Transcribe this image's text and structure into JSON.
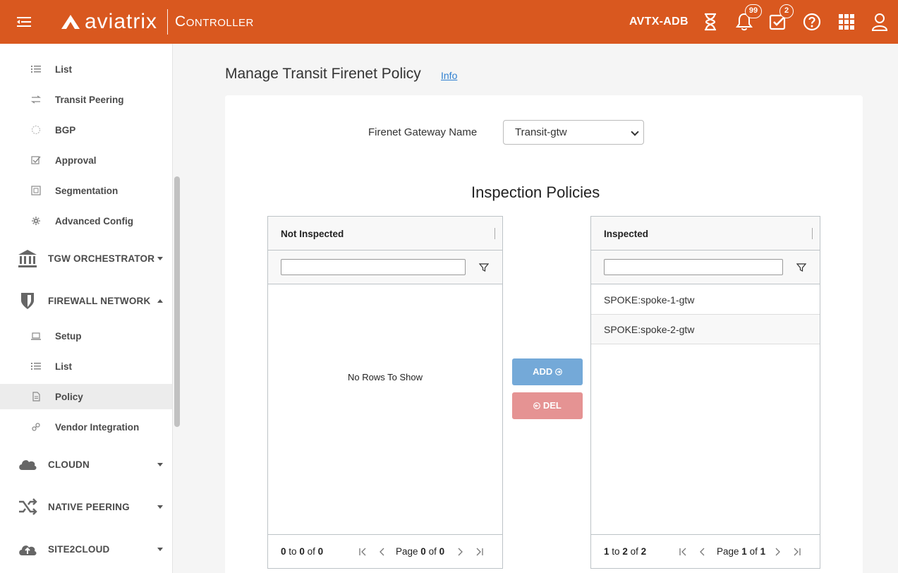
{
  "header": {
    "brand": "aviatrix",
    "product": "Controller",
    "account": "AVTX-ADB",
    "notifications_count": "99",
    "tasks_count": "2",
    "colors": {
      "bar": "#d9581f"
    }
  },
  "sidebar": {
    "items": [
      {
        "label": "List",
        "icon": "list-icon"
      },
      {
        "label": "Transit Peering",
        "icon": "arrows-icon"
      },
      {
        "label": "BGP",
        "icon": "bgp-icon"
      },
      {
        "label": "Approval",
        "icon": "approval-icon"
      },
      {
        "label": "Segmentation",
        "icon": "segmentation-icon"
      },
      {
        "label": "Advanced Config",
        "icon": "gear-icon"
      }
    ],
    "sections": {
      "tgw": "TGW ORCHESTRATOR",
      "firewall": "FIREWALL NETWORK",
      "cloudn": "CLOUDN",
      "native": "NATIVE PEERING",
      "site2cloud": "SITE2CLOUD"
    },
    "firewall_items": [
      {
        "label": "Setup",
        "icon": "laptop-icon"
      },
      {
        "label": "List",
        "icon": "list-icon"
      },
      {
        "label": "Policy",
        "icon": "document-icon",
        "active": true
      },
      {
        "label": "Vendor Integration",
        "icon": "link-icon"
      }
    ]
  },
  "main": {
    "title": "Manage Transit Firenet Policy",
    "info_link": "Info",
    "gateway_label": "Firenet Gateway Name",
    "gateway_value": "Transit-gtw",
    "policies_title": "Inspection Policies",
    "add_label": "ADD",
    "del_label": "DEL",
    "not_inspected": {
      "header": "Not Inspected",
      "empty_text": "No Rows To Show",
      "from": "0",
      "to": "0",
      "total": "0",
      "page": "0",
      "pages": "0"
    },
    "inspected": {
      "header": "Inspected",
      "rows": [
        "SPOKE:spoke-1-gtw",
        "SPOKE:spoke-2-gtw"
      ],
      "from": "1",
      "to": "2",
      "total": "2",
      "page": "1",
      "pages": "1"
    },
    "word_to": "to",
    "word_of": "of",
    "word_page": "Page"
  }
}
